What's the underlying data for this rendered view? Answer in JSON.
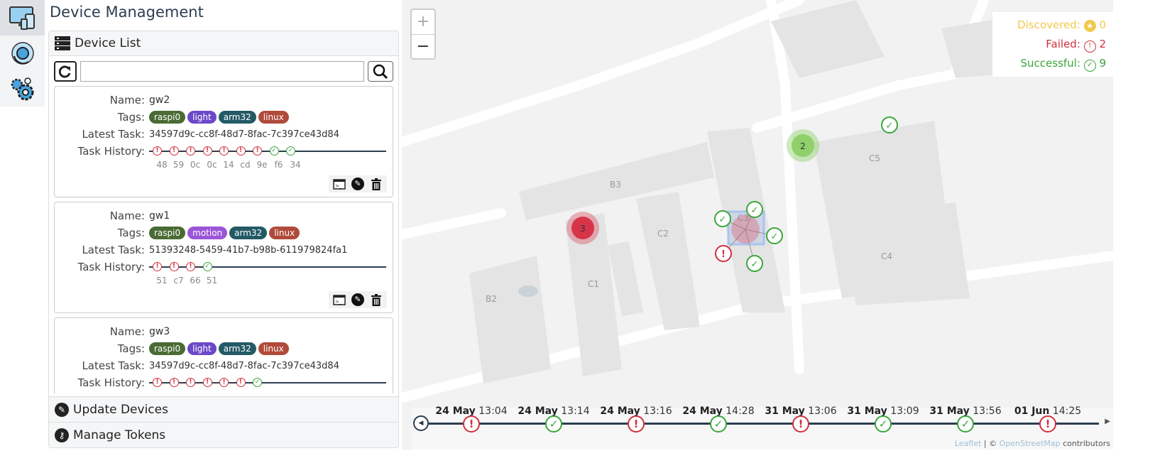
{
  "nav": [
    {
      "icon": "devices-icon",
      "active": true
    },
    {
      "icon": "update-icon"
    },
    {
      "icon": "settings-gears-icon"
    }
  ],
  "title": "Device Management",
  "device_list": {
    "heading": "Device List",
    "search_placeholder": "",
    "search_value": ""
  },
  "labels": {
    "name": "Name:",
    "tags": "Tags:",
    "latest": "Latest Task:",
    "history": "Task History:"
  },
  "tag_colors": {
    "raspi0": "#4a6b34",
    "light": "#6a48c8",
    "motion": "#9b55d8",
    "arm32": "#235a66",
    "linux": "#b04a3a"
  },
  "status_colors": {
    "failed": "#d0303d",
    "success": "#3aa63a",
    "discovered": "#f2c94c"
  },
  "devices": [
    {
      "name": "gw2",
      "tags": [
        "raspi0",
        "light",
        "arm32",
        "linux"
      ],
      "latest_task": "34597d9c-cc8f-48d7-8fac-7c397ce43d84",
      "history": [
        [
          "f",
          "48"
        ],
        [
          "f",
          "59"
        ],
        [
          "f",
          "0c"
        ],
        [
          "f",
          "0c"
        ],
        [
          "f",
          "14"
        ],
        [
          "f",
          "cd"
        ],
        [
          "f",
          "9e"
        ],
        [
          "s",
          "f6"
        ],
        [
          "s",
          "34"
        ]
      ]
    },
    {
      "name": "gw1",
      "tags": [
        "raspi0",
        "motion",
        "arm32",
        "linux"
      ],
      "latest_task": "51393248-5459-41b7-b98b-611979824fa1",
      "history": [
        [
          "f",
          "51"
        ],
        [
          "f",
          "c7"
        ],
        [
          "f",
          "66"
        ],
        [
          "s",
          "51"
        ]
      ]
    },
    {
      "name": "gw3",
      "tags": [
        "raspi0",
        "light",
        "arm32",
        "linux"
      ],
      "latest_task": "34597d9c-cc8f-48d7-8fac-7c397ce43d84",
      "history": [
        [
          "f",
          ""
        ],
        [
          "f",
          ""
        ],
        [
          "f",
          ""
        ],
        [
          "f",
          ""
        ],
        [
          "f",
          ""
        ],
        [
          "f",
          ""
        ],
        [
          "s",
          ""
        ]
      ]
    }
  ],
  "sections": {
    "update": "Update Devices",
    "tokens": "Manage Tokens"
  },
  "map": {
    "zoom_in": "+",
    "zoom_out": "−",
    "legend": [
      {
        "label": "Discovered:",
        "count": "0",
        "status": "discovered"
      },
      {
        "label": "Failed:",
        "count": "2",
        "status": "failed"
      },
      {
        "label": "Successful:",
        "count": "9",
        "status": "success"
      }
    ],
    "buildings": [
      "B2",
      "B3",
      "C1",
      "C2",
      "C3",
      "C4",
      "C5"
    ],
    "clusters": [
      {
        "count": "3",
        "status": "failed"
      },
      {
        "count": "2",
        "status": "success"
      }
    ],
    "timeline": [
      {
        "date": "24 May",
        "time": "13:04",
        "status": "failed"
      },
      {
        "date": "24 May",
        "time": "13:14",
        "status": "success"
      },
      {
        "date": "24 May",
        "time": "13:16",
        "status": "failed"
      },
      {
        "date": "24 May",
        "time": "14:28",
        "status": "success"
      },
      {
        "date": "31 May",
        "time": "13:06",
        "status": "failed"
      },
      {
        "date": "31 May",
        "time": "13:09",
        "status": "success"
      },
      {
        "date": "31 May",
        "time": "13:56",
        "status": "success"
      },
      {
        "date": "01 Jun",
        "time": "14:25",
        "status": "failed"
      }
    ],
    "attribution": {
      "leaflet": "Leaflet",
      "sep": " | © ",
      "osm": "OpenStreetMap",
      "rest": " contributors"
    }
  }
}
